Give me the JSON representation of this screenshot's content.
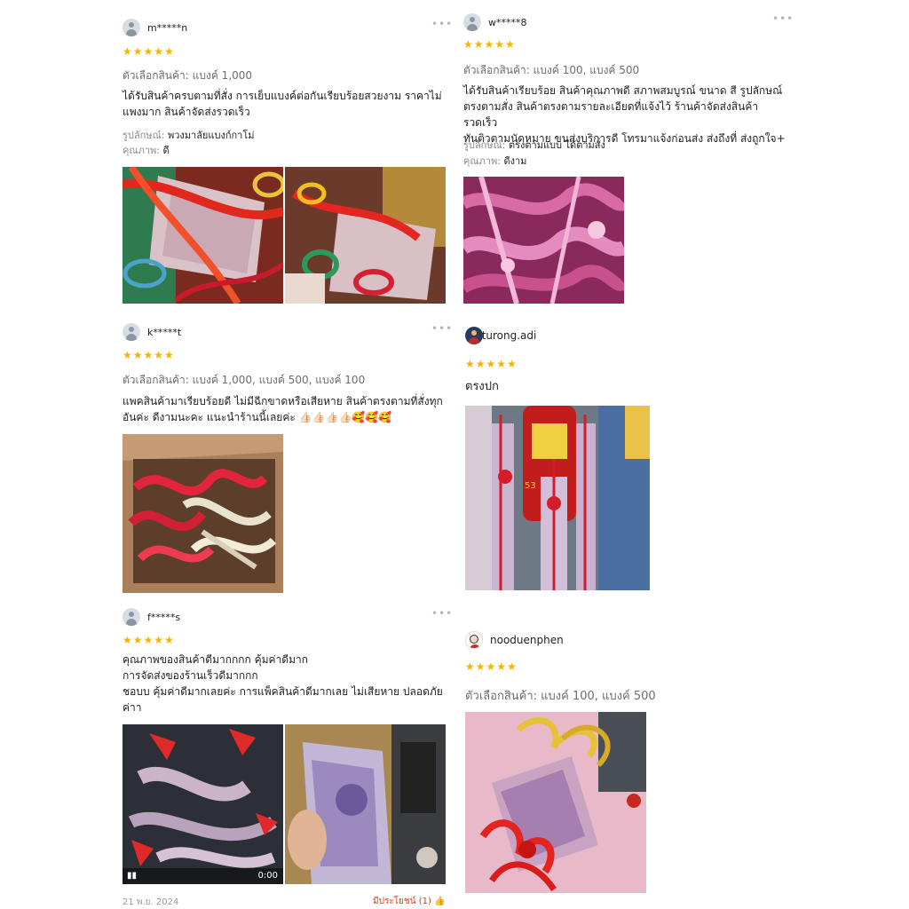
{
  "stars": "★★★★★",
  "more_label": "•••",
  "reviews": [
    {
      "username": "m*****n",
      "variant_label": "ตัวเลือกสินค้า:",
      "variant_value": "แบงค์  1,000",
      "lines": [
        "ได้รับสินค้าครบตามที่สั่ง การเย็บแบงค์ต่อกันเรียบร้อยสวยงาม ราคาไม่",
        "แพงมาก สินค้าจัดส่งรวดเร็ว"
      ],
      "attr1_label": "รูปลักษณ์:",
      "attr1_value": "พวงมาลัยแบงก์กาโม่",
      "attr2_label": "คุณภาพ:",
      "attr2_value": "ดี"
    },
    {
      "username": "w*****8",
      "variant_label": "ตัวเลือกสินค้า:",
      "variant_value": "แบงค์ 100, แบงค์ 500",
      "lines": [
        "ได้รับสินค้าเรียบร้อย สินค้าคุณภาพดี สภาพสมบูรณ์ ขนาด สี รูปลักษณ์",
        "ตรงตามสั่ง สินค้าตรงตามรายละเอียดที่แจ้งไว้ ร้านค้าจัดส่งสินค้ารวดเร็ว",
        "ทันติวตามนัดหมาย ขนส่งบริการดี โทรมาแจ้งก่อนส่ง ส่งถึงที่ ส่งถูกใจ+"
      ],
      "attr1_label": "รูปลักษณ์:",
      "attr1_value": "ตรงตามแบบ ได้ตามสั่ง",
      "attr2_label": "คุณภาพ:",
      "attr2_value": "ดีงาม"
    },
    {
      "username": "k*****t",
      "variant_label": "ตัวเลือกสินค้า:",
      "variant_value": "แบงค์  1,000, แบงค์ 500, แบงค์ 100",
      "lines": [
        "แพคสินค้ามาเรียบร้อยดี ไม่มีฉีกขาดหรือเสียหาย สินค้าตรงตามที่สั่งทุก",
        "อันค่ะ ดีงามนะคะ แนะนำร้านนี้เลยค่ะ 👍🏻👍🏻👍🏻👍🏻🥰🥰🥰"
      ]
    },
    {
      "username": "jaturong.adi",
      "lines": [
        "ตรงปก"
      ]
    },
    {
      "username": "f*****s",
      "lines": [
        "คุณภาพของสินค้าดีมากกกก คุ้มค่าดีมาก",
        "การจัดส่งของร้านเร็วดีมากกก",
        "ชอบบ คุ้มค่าดีมากเลยค่ะ การแพ็คสินค้าดีมากเลย ไม่เสียหาย ปลอดภัย",
        "ค่าา"
      ],
      "video_duration": "0:00",
      "date": "21 พ.ย. 2024",
      "helpful": "มีประโยชน์ (1)"
    },
    {
      "username": "nooduenphen",
      "variant_label": "ตัวเลือกสินค้า:",
      "variant_value": "แบงค์ 100, แบงค์ 500"
    }
  ]
}
